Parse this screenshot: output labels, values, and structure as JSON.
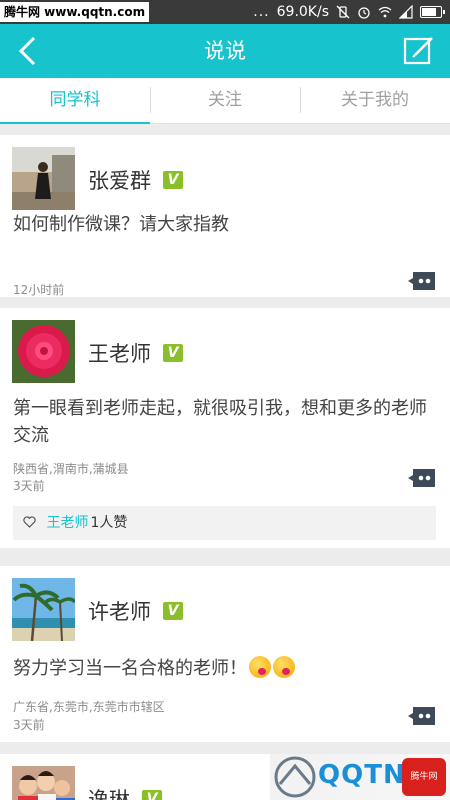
{
  "status_bar": {
    "watermark": "腾牛网 www.qqtn.com",
    "dots": "...",
    "speed": "69.0K/s"
  },
  "header": {
    "title": "说说"
  },
  "tabs": [
    {
      "label": "同学科",
      "active": true
    },
    {
      "label": "关注",
      "active": false
    },
    {
      "label": "关于我的",
      "active": false
    }
  ],
  "posts": [
    {
      "name": "张爱群",
      "badge": "V",
      "content": "如何制作微课？请大家指教",
      "location": "",
      "time": "12小时前"
    },
    {
      "name": "王老师",
      "badge": "V",
      "content": "第一眼看到老师走起，就很吸引我，想和更多的老师交流",
      "location": "陕西省,渭南市,蒲城县",
      "time": "3天前",
      "likes": {
        "liker": "王老师",
        "count_text": "1人赞"
      }
    },
    {
      "name": "许老师",
      "badge": "V",
      "content": "努力学习当一名合格的老师！",
      "location": "广东省,东莞市,东莞市市辖区",
      "time": "3天前"
    },
    {
      "name": "逸琳",
      "badge": "V"
    }
  ],
  "bottom_watermark": {
    "logo_text": "QQTN",
    "tag_text": "腾牛网"
  },
  "colors": {
    "accent": "#17c3cc",
    "verified": "#8bbf2a"
  }
}
